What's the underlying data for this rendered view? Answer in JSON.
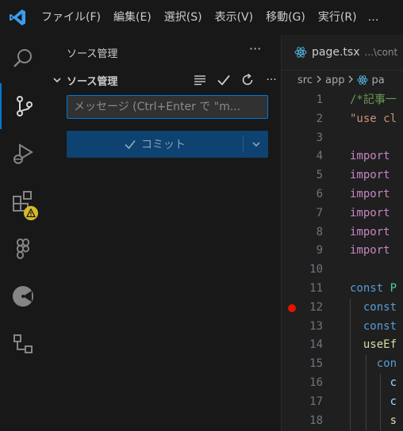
{
  "titlebar": {
    "menu": [
      "ファイル(F)",
      "編集(E)",
      "選択(S)",
      "表示(V)",
      "移動(G)",
      "実行(R)"
    ],
    "more": "…"
  },
  "activity": [
    "search",
    "source-control",
    "run-and-debug",
    "extensions",
    "figma",
    "timeline",
    "remote"
  ],
  "sidebar": {
    "title": "ソース管理",
    "more": "···",
    "section_title": "ソース管理",
    "section_more": "···",
    "message_placeholder": "メッセージ (Ctrl+Enter で \"m...",
    "commit_label": "コミット"
  },
  "editor": {
    "tab_name": "page.tsx",
    "tab_path": "...\\cont",
    "breadcrumb": [
      "src",
      "app",
      "pa"
    ],
    "lines": [
      {
        "n": "1",
        "parts": [
          {
            "t": "/*記事一",
            "c": "#6a9955"
          }
        ]
      },
      {
        "n": "2",
        "parts": [
          {
            "t": "\"use cl",
            "c": "#ce9178"
          }
        ]
      },
      {
        "n": "3",
        "parts": []
      },
      {
        "n": "4",
        "parts": [
          {
            "t": "import",
            "c": "#c586c0"
          }
        ]
      },
      {
        "n": "5",
        "parts": [
          {
            "t": "import",
            "c": "#c586c0"
          }
        ]
      },
      {
        "n": "6",
        "parts": [
          {
            "t": "import",
            "c": "#c586c0"
          }
        ]
      },
      {
        "n": "7",
        "parts": [
          {
            "t": "import",
            "c": "#c586c0"
          }
        ]
      },
      {
        "n": "8",
        "parts": [
          {
            "t": "import",
            "c": "#c586c0"
          }
        ]
      },
      {
        "n": "9",
        "parts": [
          {
            "t": "import",
            "c": "#c586c0"
          }
        ]
      },
      {
        "n": "10",
        "parts": []
      },
      {
        "n": "11",
        "parts": [
          {
            "t": "const ",
            "c": "#569cd6"
          },
          {
            "t": "P",
            "c": "#4ec9b0"
          }
        ]
      },
      {
        "n": "12",
        "parts": [
          {
            "t": "  const",
            "c": "#569cd6"
          }
        ],
        "breakpoint": true
      },
      {
        "n": "13",
        "parts": [
          {
            "t": "  const",
            "c": "#569cd6"
          }
        ]
      },
      {
        "n": "14",
        "parts": [
          {
            "t": "  useEf",
            "c": "#dcdcaa"
          }
        ]
      },
      {
        "n": "15",
        "parts": [
          {
            "t": "    con",
            "c": "#569cd6"
          }
        ]
      },
      {
        "n": "16",
        "parts": [
          {
            "t": "      c",
            "c": "#9cdcfe"
          }
        ]
      },
      {
        "n": "17",
        "parts": [
          {
            "t": "      c",
            "c": "#9cdcfe"
          }
        ]
      },
      {
        "n": "18",
        "parts": [
          {
            "t": "      s",
            "c": "#dcdcaa"
          }
        ]
      }
    ]
  },
  "colors": {
    "accent": "#0078d4",
    "warning": "#d7ba28",
    "breakpoint": "#e51400",
    "commit_button": "#0e4270"
  }
}
